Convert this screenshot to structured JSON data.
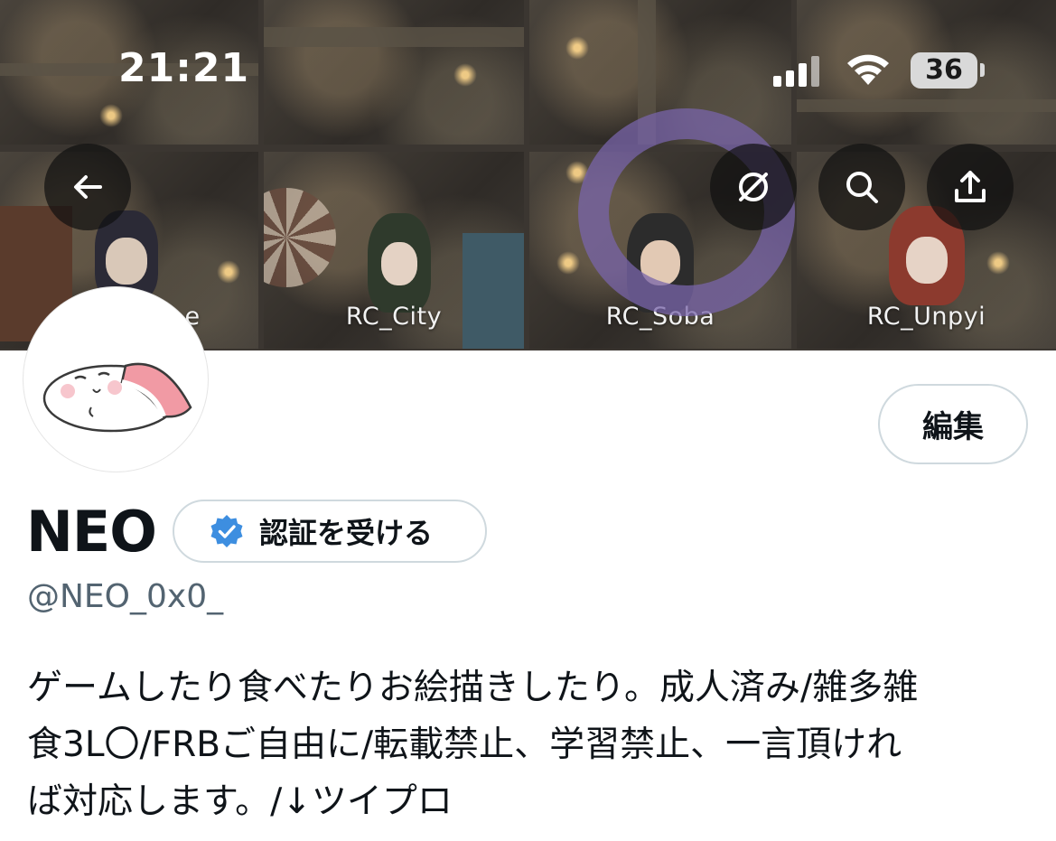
{
  "status_bar": {
    "time": "21:21",
    "battery": "36"
  },
  "banner": {
    "tiles": [
      {
        "label": ""
      },
      {
        "label": ""
      },
      {
        "label": ""
      },
      {
        "label": ""
      },
      {
        "label": "e"
      },
      {
        "label": "RC_City"
      },
      {
        "label": "RC_Soba"
      },
      {
        "label": "RC_Unpyi"
      }
    ]
  },
  "header_buttons": {
    "back": "back-arrow-icon",
    "hide": "eye-slash-icon",
    "search": "search-icon",
    "share": "share-icon"
  },
  "profile": {
    "edit_label": "編集",
    "name": "NEO",
    "verify_label": "認証を受ける",
    "handle": "@NEO_0x0_",
    "bio": "ゲームしたり食べたりお絵描きしたり。成人済み/雑多雑\n食3L〇/FRBご自由に/転載禁止、学習禁止、一言頂けれ\nば対応します。/↓ツイプロ"
  },
  "colors": {
    "verify_badge": "#3d8ee0",
    "handle_text": "#536471",
    "border": "#cfd9de"
  }
}
